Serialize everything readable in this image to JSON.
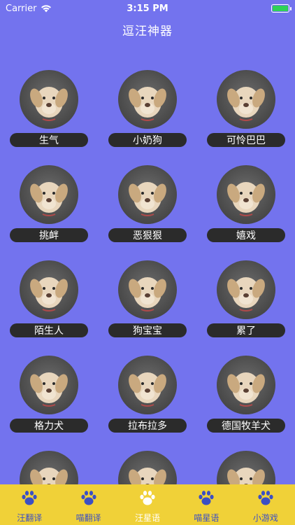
{
  "status": {
    "carrier": "Carrier",
    "time": "3:15 PM"
  },
  "title": "逗汪神器",
  "grid_items": [
    {
      "label": "生气"
    },
    {
      "label": "小奶狗"
    },
    {
      "label": "可怜巴巴"
    },
    {
      "label": "挑衅"
    },
    {
      "label": "恶狠狠"
    },
    {
      "label": "嬉戏"
    },
    {
      "label": "陌生人"
    },
    {
      "label": "狗宝宝"
    },
    {
      "label": "累了"
    },
    {
      "label": "格力犬"
    },
    {
      "label": "拉布拉多"
    },
    {
      "label": "德国牧羊犬"
    }
  ],
  "tabs": [
    {
      "label": "汪翻译",
      "active": false
    },
    {
      "label": "喵翻译",
      "active": false
    },
    {
      "label": "汪星语",
      "active": true
    },
    {
      "label": "喵星语",
      "active": false
    },
    {
      "label": "小游戏",
      "active": false
    }
  ],
  "colors": {
    "background": "#7373EE",
    "tab_bar": "#F0D138",
    "tab_inactive": "#3B4FC4",
    "tab_active": "#ffffff",
    "pill": "#2b2b2b"
  }
}
